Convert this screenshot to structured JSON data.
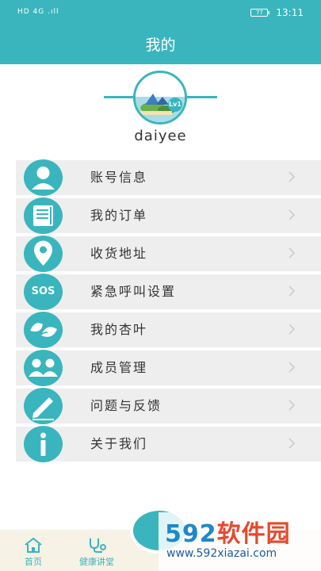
{
  "status_bar": {
    "left": "HD 4G .ıll",
    "battery": "77",
    "time": "13:11"
  },
  "header": {
    "title": "我的"
  },
  "profile": {
    "username": "daiyee",
    "level": "Lv1"
  },
  "menu": [
    {
      "label": "账号信息",
      "icon": "person-icon"
    },
    {
      "label": "我的订单",
      "icon": "order-list-icon"
    },
    {
      "label": "收货地址",
      "icon": "location-pin-icon"
    },
    {
      "label": "紧急呼叫设置",
      "icon": "sos-icon",
      "icon_text": "SOS"
    },
    {
      "label": "我的杏叶",
      "icon": "leaves-icon"
    },
    {
      "label": "成员管理",
      "icon": "members-icon"
    },
    {
      "label": "问题与反馈",
      "icon": "edit-pen-icon"
    },
    {
      "label": "关于我们",
      "icon": "info-icon"
    }
  ],
  "tab_bar": {
    "tabs": [
      {
        "label": "首页",
        "icon": "home-icon"
      },
      {
        "label": "健康讲堂",
        "icon": "stethoscope-icon"
      }
    ]
  },
  "watermark": {
    "logo_digits": "592",
    "logo_text": "软件园",
    "url": "www.592xiazai.com"
  },
  "colors": {
    "accent": "#3ab5bd",
    "menu_bg": "#eeeeee",
    "tab_bg": "#f6f2e6"
  }
}
